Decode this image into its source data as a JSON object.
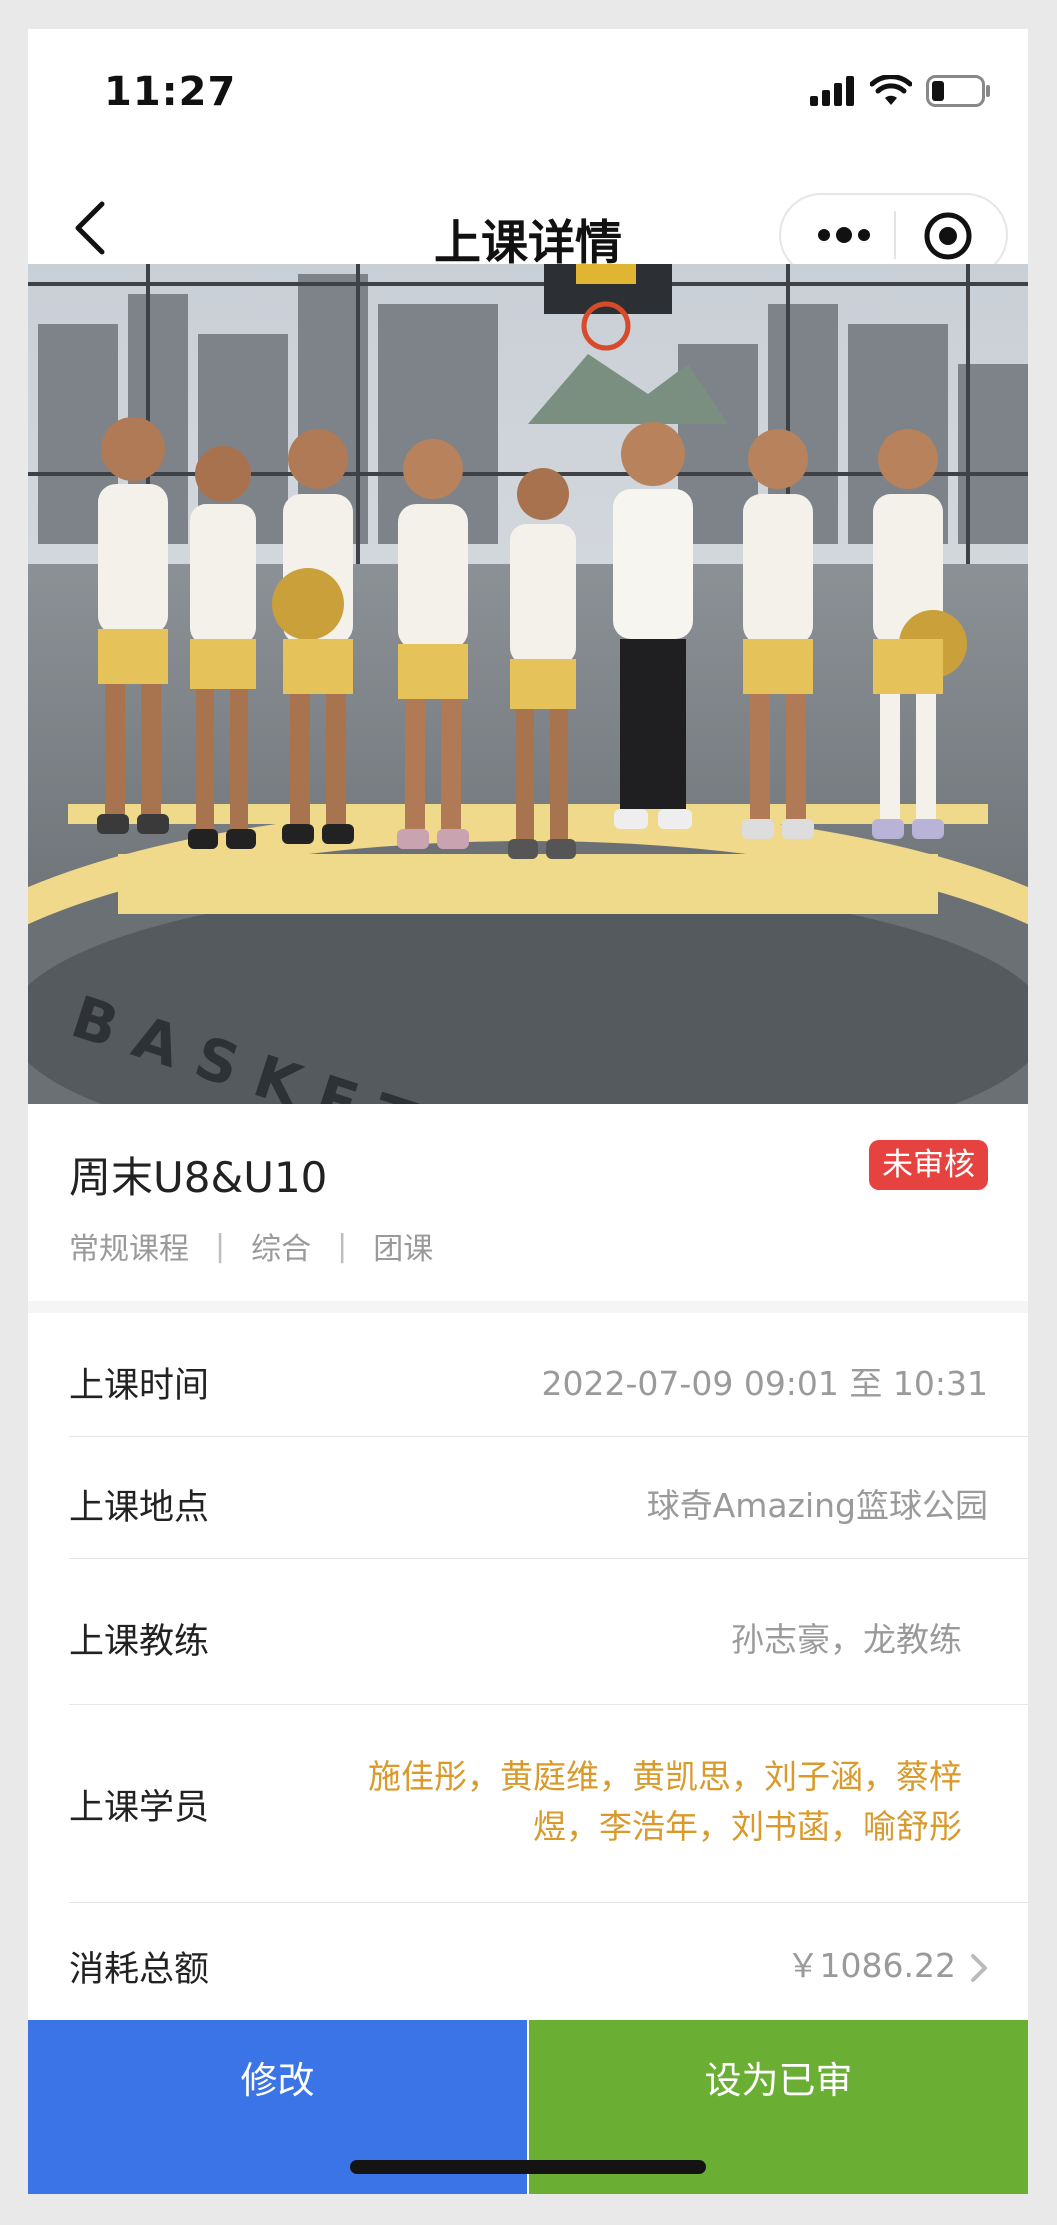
{
  "status_bar": {
    "time": "11:27",
    "icons": [
      "signal-icon",
      "wifi-icon",
      "battery-icon"
    ]
  },
  "nav": {
    "title": "上课详情",
    "back_icon": "chevron-left-icon",
    "more_icon": "more-dots-icon",
    "close_icon": "target-close-icon"
  },
  "course": {
    "title": "周末U8&U10",
    "status": "未审核",
    "tags": [
      "常规课程",
      "综合",
      "团课"
    ]
  },
  "details": {
    "time_label": "上课时间",
    "time_value": "2022-07-09 09:01 至 10:31",
    "location_label": "上课地点",
    "location_value": "球奇Amazing篮球公园",
    "coach_label": "上课教练",
    "coach_value": "孙志豪，龙教练",
    "students_label": "上课学员",
    "students_value": "施佳彤，黄庭维，黄凯思，刘子涵，蔡梓煜，李浩年，刘书菡，喻舒彤",
    "total_label": "消耗总额",
    "total_value": "￥1086.22"
  },
  "actions": {
    "edit": "修改",
    "approve": "设为已审"
  },
  "colors": {
    "edit_button": "#3a74e6",
    "approve_button": "#6aae34",
    "badge": "#e64340",
    "students_text": "#d99a2b"
  }
}
